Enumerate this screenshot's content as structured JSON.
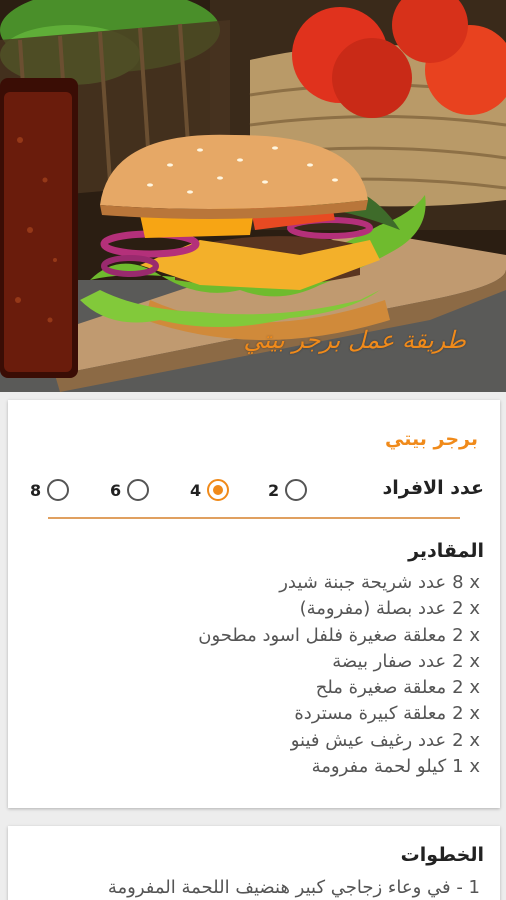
{
  "hero": {
    "overlay_title": "طريقة عمل برجر بيتي",
    "image": "burger-photo"
  },
  "recipe": {
    "name": "برجر بيتي"
  },
  "servings": {
    "label": "عدد الافراد",
    "options": [
      {
        "value": "2",
        "selected": false
      },
      {
        "value": "4",
        "selected": true
      },
      {
        "value": "6",
        "selected": false
      },
      {
        "value": "8",
        "selected": false
      }
    ]
  },
  "ingredients": {
    "title": "المقادير",
    "items": [
      {
        "qty": "8 x",
        "text": "عدد شريحة جبنة شيدر"
      },
      {
        "qty": "2 x",
        "text": "عدد بصلة (مفرومة)"
      },
      {
        "qty": "2 x",
        "text": "معلقة صغيرة فلفل اسود مطحون"
      },
      {
        "qty": "2 x",
        "text": "عدد صفار بيضة"
      },
      {
        "qty": "2 x",
        "text": "معلقة صغيرة ملح"
      },
      {
        "qty": "2 x",
        "text": "معلقة كبيرة مستردة"
      },
      {
        "qty": "2 x",
        "text": "عدد رغيف عيش فينو"
      },
      {
        "qty": "1 x",
        "text": "كيلو لحمة مفرومة"
      }
    ]
  },
  "steps": {
    "title": "الخطوات",
    "items": [
      "1 - في وعاء زجاجي كبير هنضيف اللحمة المفرومة"
    ]
  },
  "colors": {
    "accent": "#f08a1a",
    "text_dark": "#222222",
    "text_muted": "#555555",
    "background": "#ededed"
  }
}
